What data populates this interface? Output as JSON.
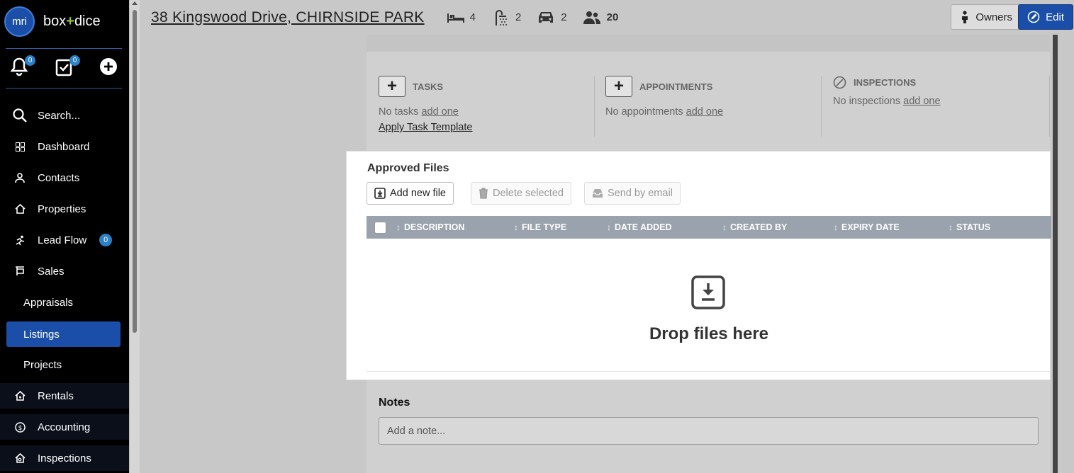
{
  "brand": {
    "logo_text": "mri",
    "name": "box+dice"
  },
  "quick_actions": {
    "notifications_count": "0",
    "tasks_count": "0"
  },
  "sidebar": {
    "search_label": "Search...",
    "items": [
      {
        "label": "Dashboard"
      },
      {
        "label": "Contacts"
      },
      {
        "label": "Properties"
      },
      {
        "label": "Lead Flow",
        "badge": "0"
      },
      {
        "label": "Sales"
      },
      {
        "label": "Appraisals"
      },
      {
        "label": "Listings"
      },
      {
        "label": "Projects"
      },
      {
        "label": "Rentals"
      },
      {
        "label": "Accounting"
      },
      {
        "label": "Inspections"
      }
    ]
  },
  "header": {
    "title": "38 Kingswood Drive, CHIRNSIDE PARK",
    "bedrooms": "4",
    "bathrooms": "2",
    "car_spaces": "2",
    "contacts": "20",
    "owners_label": "Owners",
    "edit_label": "Edit"
  },
  "tasks_section": {
    "tasks": {
      "title": "TASKS",
      "empty": "No tasks",
      "add_link": "add one",
      "template_link": "Apply Task Template"
    },
    "appointments": {
      "title": "APPOINTMENTS",
      "empty": "No appointments",
      "add_link": "add one"
    },
    "inspections": {
      "title": "INSPECTIONS",
      "empty": "No inspections",
      "add_link": "add one"
    }
  },
  "files": {
    "title": "Approved Files",
    "add_label": "Add new file",
    "delete_label": "Delete selected",
    "email_label": "Send by email",
    "columns": [
      "DESCRIPTION",
      "FILE TYPE",
      "DATE ADDED",
      "CREATED BY",
      "EXPIRY DATE",
      "STATUS"
    ],
    "drop_text": "Drop files here"
  },
  "notes": {
    "title": "Notes",
    "placeholder": "Add a note..."
  }
}
